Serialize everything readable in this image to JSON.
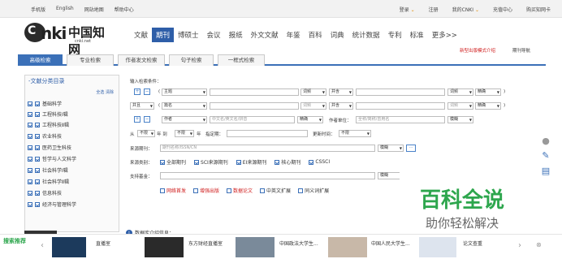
{
  "topbar": {
    "left": [
      "手机版",
      "English",
      "网站地图",
      "帮助中心"
    ],
    "right": [
      "登录",
      "注册",
      "我的CNKI",
      "充值中心",
      "购买知网卡"
    ]
  },
  "logo": {
    "cn": "中国知网",
    "net": "cnki.net"
  },
  "nav": [
    "文献",
    "期刊",
    "博硕士",
    "会议",
    "报纸",
    "外文文献",
    "年鉴",
    "百科",
    "词典",
    "统计数据",
    "专利",
    "标准",
    "更多>>"
  ],
  "nav_active": "期刊",
  "notice_new": "新型出版模式介绍",
  "help": "期刊导航",
  "tabs": [
    "高级检索",
    "专业检索",
    "作者发文检索",
    "句子检索",
    "一框式检索"
  ],
  "sidebar": {
    "title": "文献分类目录",
    "select_all": "全选 清除",
    "cats": [
      "基础科学",
      "工程科技Ⅰ辑",
      "工程科技Ⅱ辑",
      "农业科技",
      "医药卫生科技",
      "哲学与人文科学",
      "社会科学Ⅰ辑",
      "社会科学Ⅱ辑",
      "信息科技",
      "经济与管理科学"
    ]
  },
  "form": {
    "title": "输入检索条件：",
    "r1": {
      "field": "主题",
      "freq": "词频",
      "match": "精确",
      "op": "并含"
    },
    "r2": {
      "logic": "并且",
      "field": "篇名",
      "freq": "词频",
      "op": "并含",
      "match": "精确"
    },
    "r3": {
      "field": "作者",
      "placeholder": "中文名/英文名/拼音",
      "match": "精确",
      "unit_label": "作者单位：",
      "unit_ph": "全称/简称/曾用名",
      "umatch": "模糊"
    },
    "r4": {
      "from": "从",
      "y1": "不限",
      "year_to": "年 到",
      "y2": "不限",
      "year": "年",
      "period": "指定期：",
      "update": "更新时间：",
      "upd": "不限"
    },
    "r5": {
      "label": "来源期刊：",
      "placeholder": "期刊名称/ISSN/CN",
      "match": "模糊",
      "more": "···"
    },
    "r6": {
      "label": "来源类别：",
      "opts": [
        "全部期刊",
        "SCI来源期刊",
        "EI来源期刊",
        "核心期刊",
        "CSSCI"
      ]
    },
    "r7": {
      "label": "支持基金：",
      "match": "模糊"
    },
    "r8": {
      "opts": [
        "网络首发",
        "增强出版",
        "数据论文",
        "中英文扩展",
        "同义词扩展"
      ]
    }
  },
  "baike": {
    "name": "百科全说",
    "slogan": "助你轻松解决"
  },
  "notice": "数据库介绍信息：",
  "bottom": {
    "tag": "搜索推荐",
    "items": [
      "直播室",
      "东方财经直播室",
      "中国政法大学生...",
      "中国人民大学生...",
      "论文查重"
    ]
  }
}
